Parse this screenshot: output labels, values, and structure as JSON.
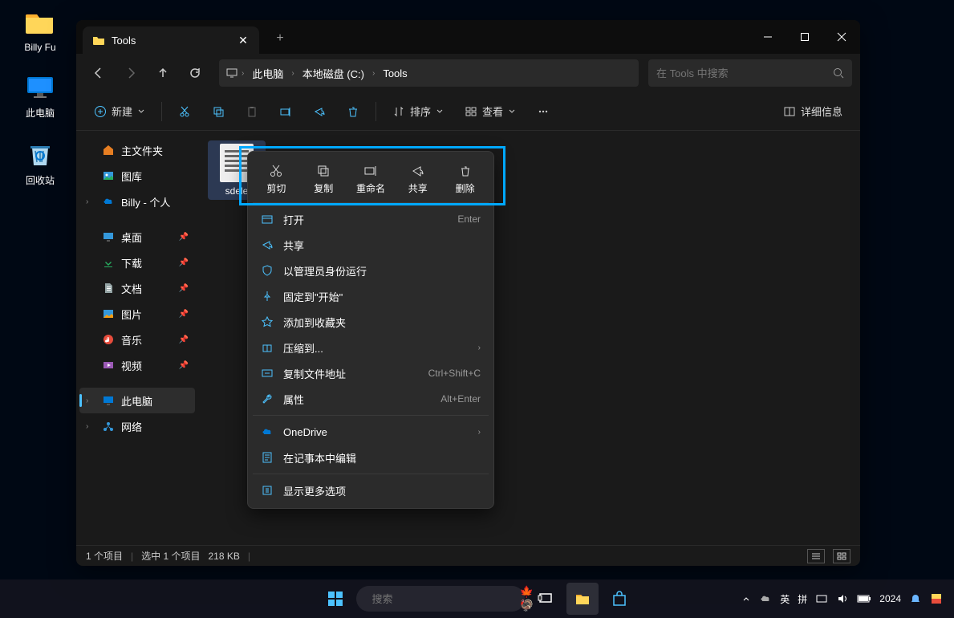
{
  "desktop": {
    "icons": [
      {
        "label": "Billy Fu"
      },
      {
        "label": "此电脑"
      },
      {
        "label": "回收站"
      }
    ]
  },
  "explorer": {
    "tab_title": "Tools",
    "breadcrumb": {
      "items": [
        "此电脑",
        "本地磁盘 (C:)",
        "Tools"
      ]
    },
    "search_placeholder": "在 Tools 中搜索",
    "toolbar": {
      "new": "新建",
      "sort": "排序",
      "view": "查看",
      "details": "详细信息"
    },
    "sidebar": {
      "home": "主文件夹",
      "gallery": "图库",
      "personal": "Billy - 个人",
      "desktop": "桌面",
      "downloads": "下载",
      "documents": "文档",
      "pictures": "图片",
      "music": "音乐",
      "videos": "视频",
      "thispc": "此电脑",
      "network": "网络"
    },
    "file": {
      "name": "sdele"
    },
    "status": {
      "count": "1 个项目",
      "selected": "选中 1 个项目",
      "size": "218 KB"
    }
  },
  "context_menu": {
    "actions": {
      "cut": "剪切",
      "copy": "复制",
      "rename": "重命名",
      "share": "共享",
      "delete": "删除"
    },
    "items": {
      "open": "打开",
      "open_shortcut": "Enter",
      "share": "共享",
      "run_admin": "以管理员身份运行",
      "pin_start": "固定到\"开始\"",
      "favorites": "添加到收藏夹",
      "compress": "压缩到...",
      "copy_path": "复制文件地址",
      "copy_path_shortcut": "Ctrl+Shift+C",
      "properties": "属性",
      "properties_shortcut": "Alt+Enter",
      "onedrive": "OneDrive",
      "notepad": "在记事本中编辑",
      "more": "显示更多选项"
    }
  },
  "taskbar": {
    "search_placeholder": "搜索",
    "ime1": "英",
    "ime2": "拼",
    "year": "2024"
  }
}
